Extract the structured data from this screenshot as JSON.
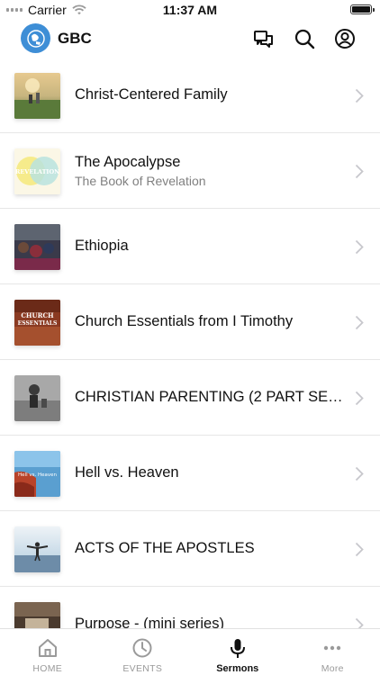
{
  "status_bar": {
    "carrier": "Carrier",
    "time": "11:37 AM"
  },
  "header": {
    "title": "GBC",
    "icons": [
      "chat-icon",
      "search-icon",
      "profile-icon"
    ]
  },
  "sermons": [
    {
      "title": "Christ-Centered Family",
      "subtitle": ""
    },
    {
      "title": "The Apocalypse",
      "subtitle": "The Book of Revelation",
      "thumb_text": "REVELATION"
    },
    {
      "title": "Ethiopia",
      "subtitle": ""
    },
    {
      "title": "Church Essentials from I Timothy",
      "subtitle": "",
      "thumb_text_1": "CHURCH",
      "thumb_text_2": "ESSENTIALS"
    },
    {
      "title": "CHRISTIAN PARENTING (2 PART SERI...",
      "subtitle": ""
    },
    {
      "title": "Hell vs. Heaven",
      "subtitle": "",
      "thumb_text": "Hell vs. Heaven"
    },
    {
      "title": "ACTS OF THE APOSTLES",
      "subtitle": ""
    },
    {
      "title": "Purpose - (mini series)",
      "subtitle": ""
    }
  ],
  "tabs": [
    {
      "label": "HOME",
      "icon": "home-icon",
      "active": false
    },
    {
      "label": "EVENTS",
      "icon": "clock-icon",
      "active": false
    },
    {
      "label": "Sermons",
      "icon": "microphone-icon",
      "active": true
    },
    {
      "label": "More",
      "icon": "more-icon",
      "active": false
    }
  ],
  "colors": {
    "brand": "#3e8ed6",
    "inactive_tab": "#9a9a9a",
    "separator": "#e6e6e6"
  }
}
